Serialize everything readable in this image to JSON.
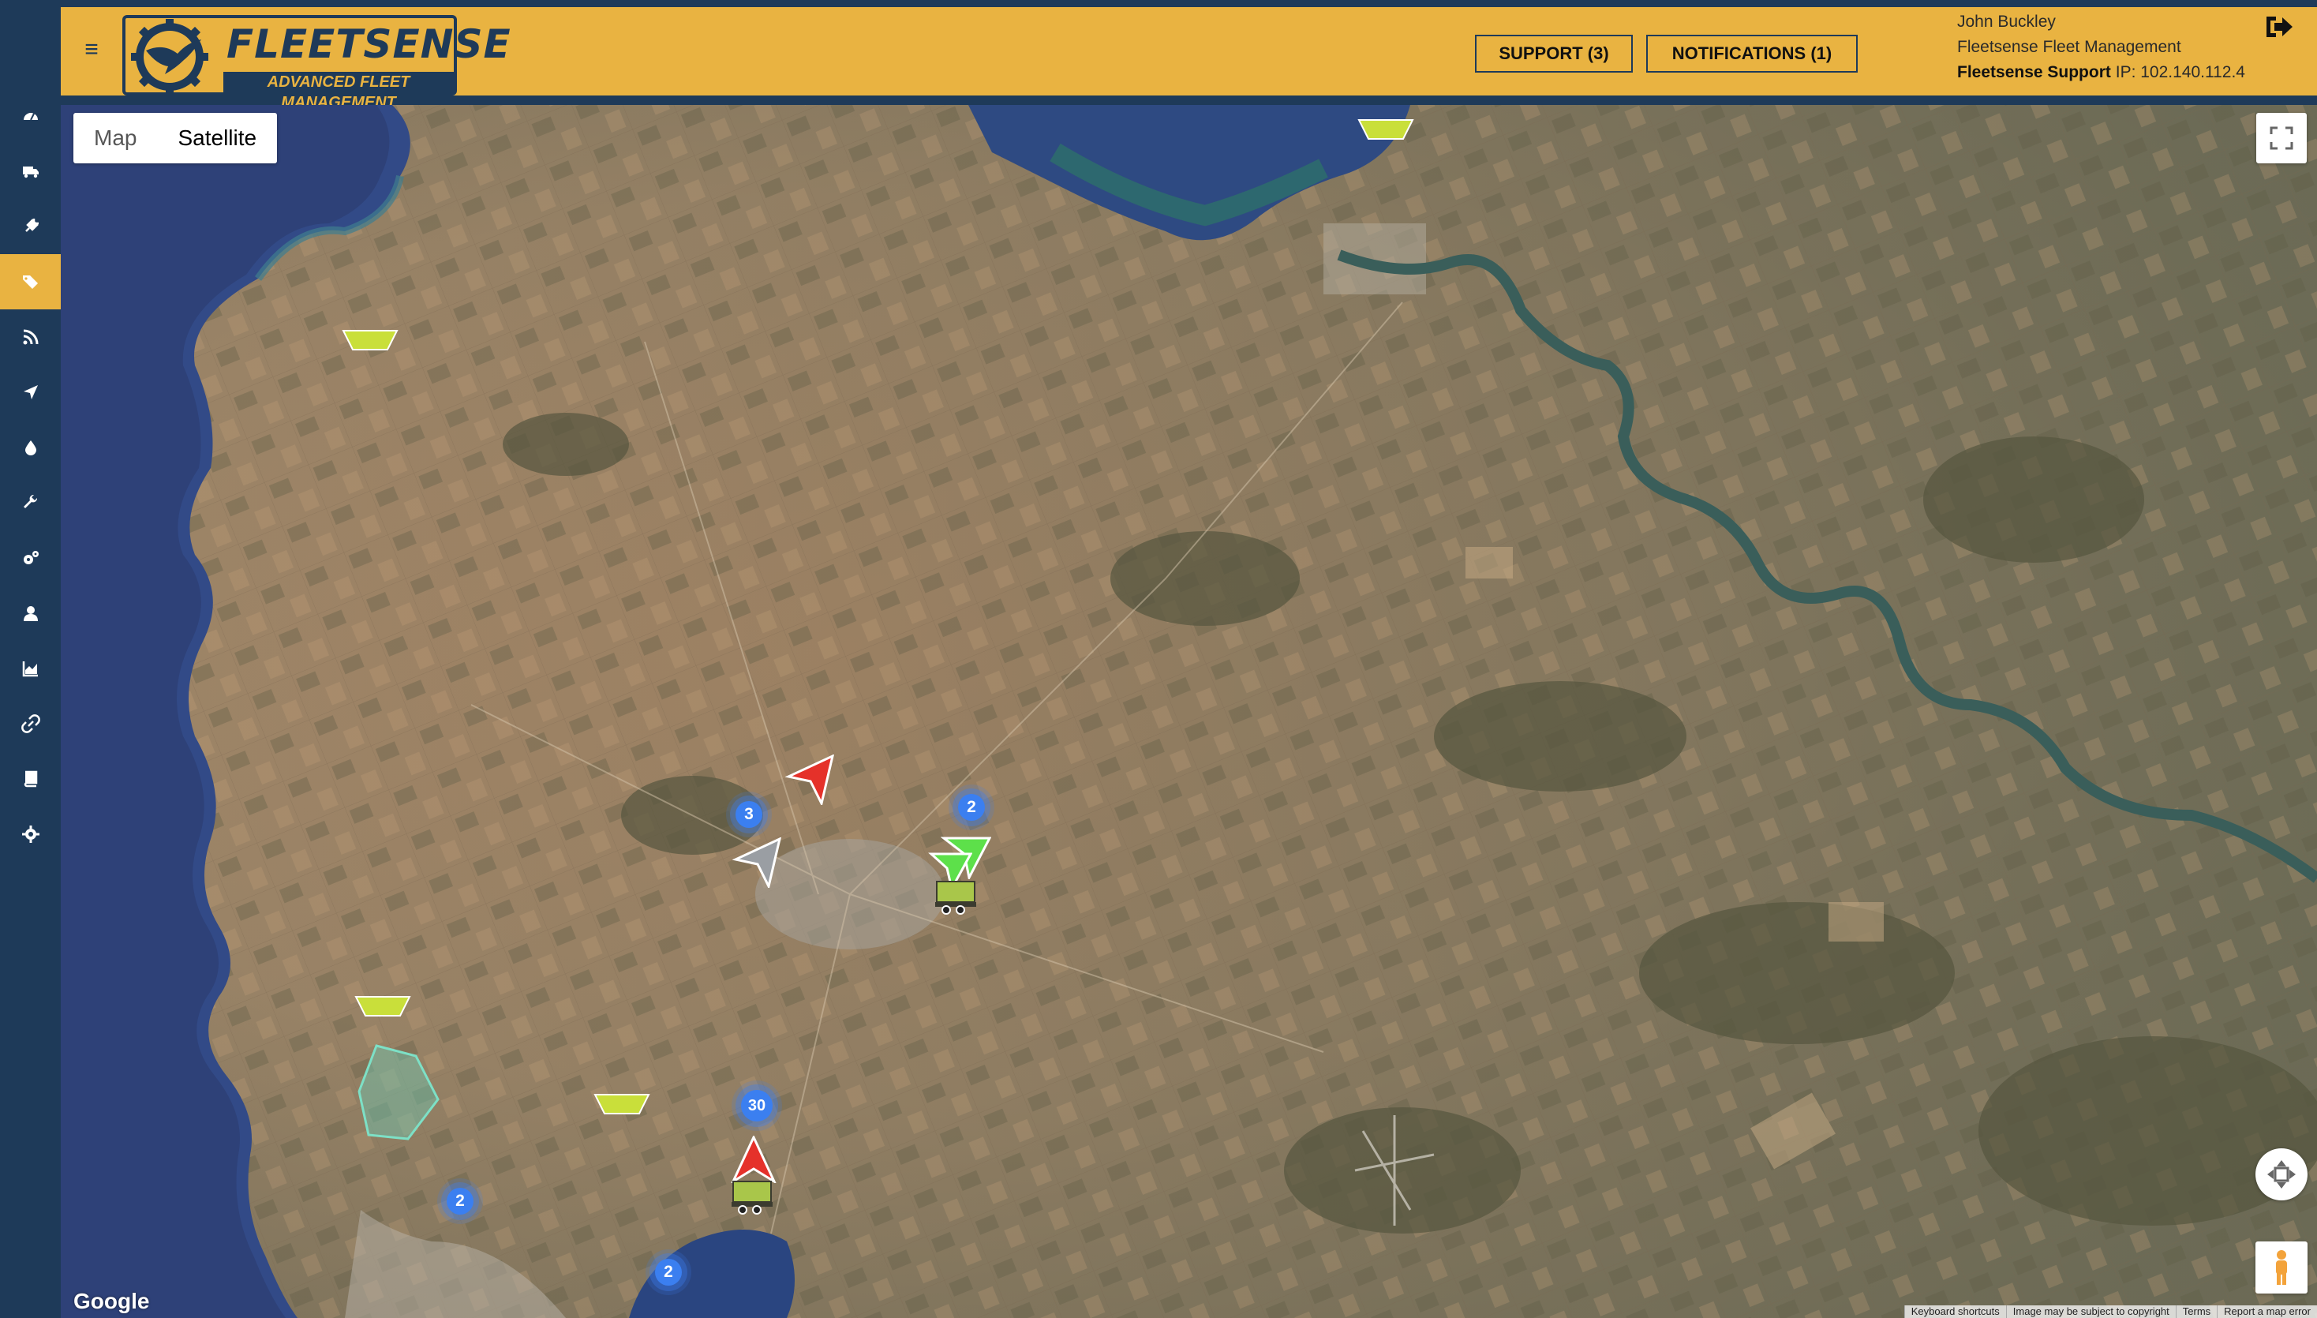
{
  "header": {
    "menu_icon": "hamburger-icon",
    "logo": {
      "title": "FLEETSENSE",
      "subtitle": "ADVANCED FLEET MANAGEMENT"
    },
    "support_label": "SUPPORT (3)",
    "notifications_label": "NOTIFICATIONS (1)",
    "user": {
      "name": "John Buckley",
      "company": "Fleetsense Fleet Management",
      "support_label": "Fleetsense Support",
      "ip": "IP: 102.140.112.4"
    },
    "logout_icon": "sign-out-icon"
  },
  "sidebar": {
    "active_index": 3,
    "items": [
      {
        "icon": "dashboard-icon"
      },
      {
        "icon": "truck-icon"
      },
      {
        "icon": "plug-icon"
      },
      {
        "icon": "tags-icon"
      },
      {
        "icon": "rss-feed-icon"
      },
      {
        "icon": "location-arrow-icon"
      },
      {
        "icon": "fuel-drop-icon"
      },
      {
        "icon": "wrench-icon"
      },
      {
        "icon": "cogs-icon"
      },
      {
        "icon": "user-icon"
      },
      {
        "icon": "area-chart-icon"
      },
      {
        "icon": "link-icon"
      },
      {
        "icon": "book-icon"
      },
      {
        "icon": "settings-icon"
      }
    ]
  },
  "map": {
    "map_type_options": [
      "Map",
      "Satellite"
    ],
    "selected_map_type": "Satellite",
    "clusters": [
      {
        "id": "cluster-a",
        "count": "3"
      },
      {
        "id": "cluster-b",
        "count": "2"
      },
      {
        "id": "cluster-c",
        "count": "30"
      },
      {
        "id": "cluster-d",
        "count": "2"
      },
      {
        "id": "cluster-e",
        "count": "2"
      }
    ],
    "google_label": "Google",
    "attribution": {
      "shortcuts": "Keyboard shortcuts",
      "copyright": "Image may be subject to copyright",
      "terms": "Terms",
      "report": "Report a map error"
    },
    "colors": {
      "vehicle_red": "#e5312a",
      "vehicle_grey": "#9a9ea3",
      "vehicle_green": "#5de04a",
      "geofence": "#c9df3a",
      "cluster_blue": "#3b7ff0"
    }
  }
}
